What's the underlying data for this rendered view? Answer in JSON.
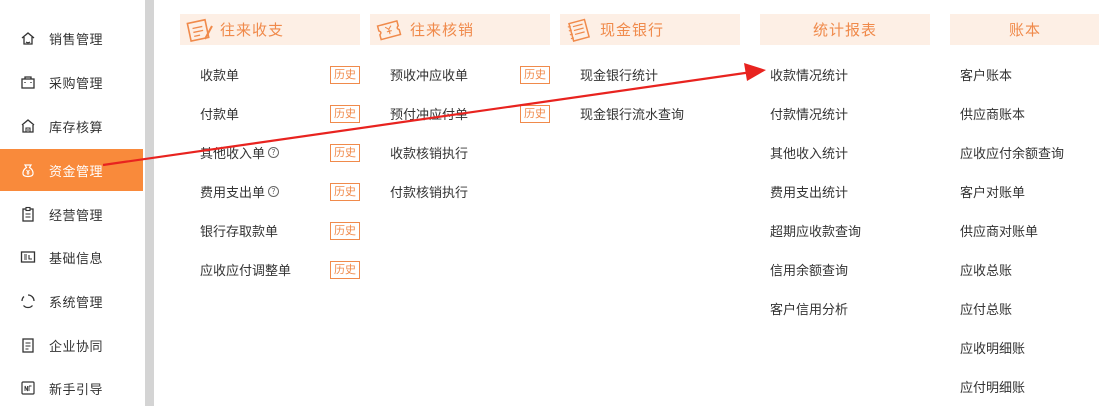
{
  "sidebar": {
    "items": [
      {
        "label": "销售管理",
        "icon": "home-icon"
      },
      {
        "label": "采购管理",
        "icon": "bag-icon"
      },
      {
        "label": "库存核算",
        "icon": "warehouse-icon"
      },
      {
        "label": "资金管理",
        "icon": "money-bag-icon",
        "active": true
      },
      {
        "label": "经营管理",
        "icon": "clipboard-icon"
      },
      {
        "label": "基础信息",
        "icon": "id-card-icon"
      },
      {
        "label": "系统管理",
        "icon": "loading-icon"
      },
      {
        "label": "企业协同",
        "icon": "document-icon"
      },
      {
        "label": "新手引导",
        "icon": "new-badge-icon"
      }
    ]
  },
  "history_label": "历史",
  "help_glyph": "?",
  "columns": {
    "wanglai": {
      "title": "往来收支",
      "items": [
        "收款单",
        "付款单",
        "其他收入单",
        "费用支出单",
        "银行存取款单",
        "应收应付调整单"
      ]
    },
    "hexiao": {
      "title": "往来核销",
      "items": [
        "预收冲应收单",
        "预付冲应付单",
        "收款核销执行",
        "付款核销执行"
      ]
    },
    "bank": {
      "title": "现金银行",
      "items": [
        "现金银行统计",
        "现金银行流水查询"
      ]
    },
    "stats": {
      "title": "统计报表",
      "items": [
        "收款情况统计",
        "付款情况统计",
        "其他收入统计",
        "费用支出统计",
        "超期应收款查询",
        "信用余额查询",
        "客户信用分析"
      ]
    },
    "ledger": {
      "title": "账本",
      "items": [
        "客户账本",
        "供应商账本",
        "应收应付余额查询",
        "客户对账单",
        "供应商对账单",
        "应收总账",
        "应付总账",
        "应收明细账",
        "应付明细账"
      ]
    }
  },
  "colors": {
    "accent": "#f98a3b",
    "header_bg": "#fdefe5",
    "header_text": "#f08a4b",
    "arrow": "#e8231f"
  }
}
